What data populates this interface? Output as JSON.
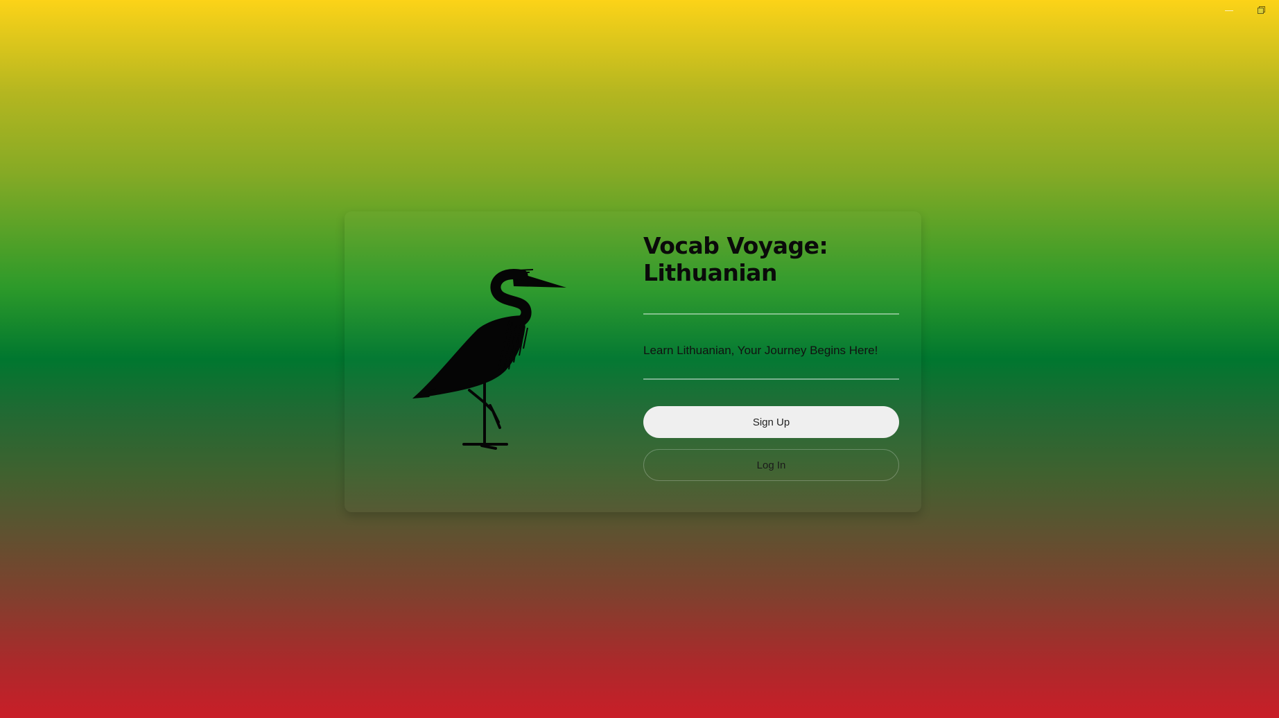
{
  "window": {
    "controls": [
      "minimize",
      "restore"
    ]
  },
  "app": {
    "title": "Vocab Voyage: Lithuanian",
    "tagline": "Learn Lithuanian, Your Journey Begins Here!",
    "logo_icon": "heron-icon"
  },
  "actions": {
    "signup_label": "Sign Up",
    "login_label": "Log In"
  },
  "colors": {
    "gradient_top": "#fcd318",
    "gradient_middle": "#00772f",
    "gradient_bottom": "#c91e28",
    "primary_button_bg": "#efefef"
  }
}
